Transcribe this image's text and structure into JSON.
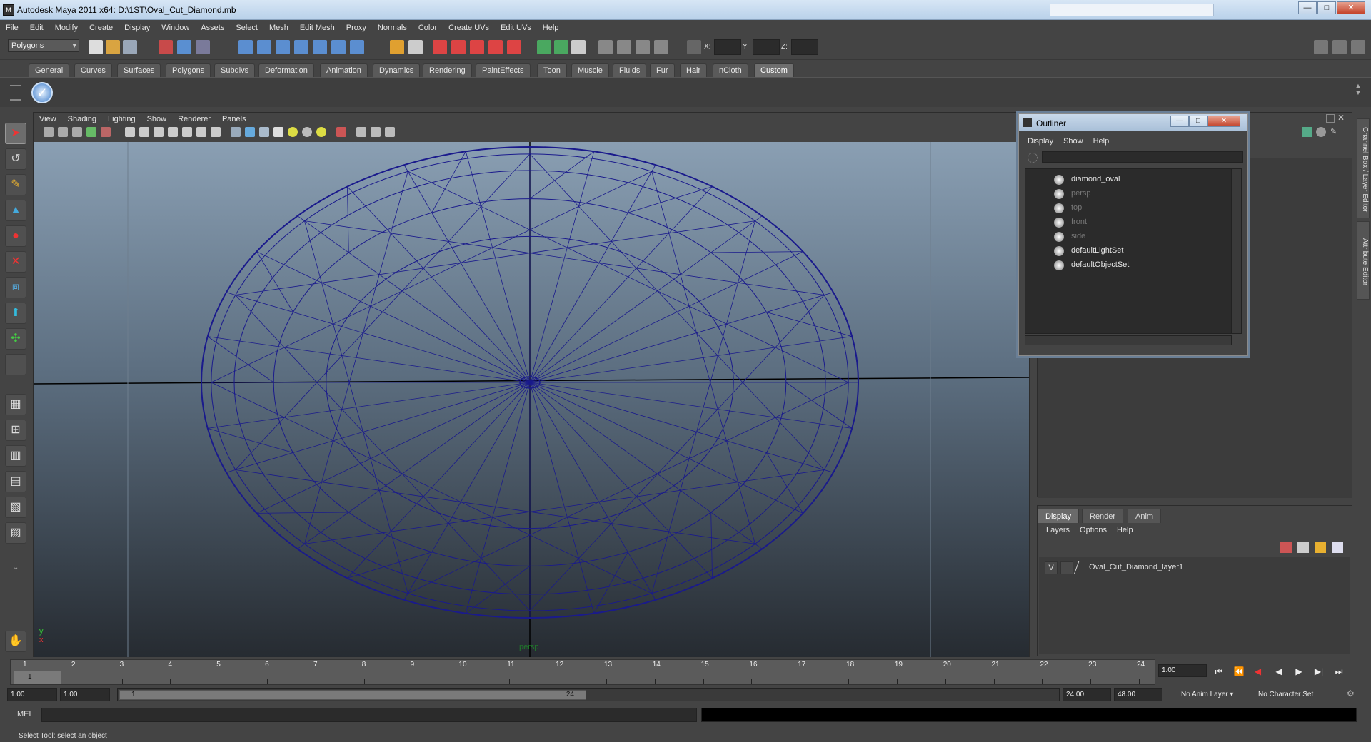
{
  "window": {
    "title": "Autodesk Maya 2011 x64: D:\\1ST\\Oval_Cut_Diamond.mb",
    "minimize": "—",
    "maximize": "□",
    "close": "✕"
  },
  "menubar": [
    "File",
    "Edit",
    "Modify",
    "Create",
    "Display",
    "Window",
    "Assets",
    "Select",
    "Mesh",
    "Edit Mesh",
    "Proxy",
    "Normals",
    "Color",
    "Create UVs",
    "Edit UVs",
    "Help"
  ],
  "statusline": {
    "mode": "Polygons",
    "x_label": "X:",
    "y_label": "Y:",
    "z_label": "Z:"
  },
  "shelf": {
    "tabs": [
      "General",
      "Curves",
      "Surfaces",
      "Polygons",
      "Subdivs",
      "Deformation",
      "Animation",
      "Dynamics",
      "Rendering",
      "PaintEffects",
      "Toon",
      "Muscle",
      "Fluids",
      "Fur",
      "Hair",
      "nCloth",
      "Custom"
    ],
    "active_tab": "Custom"
  },
  "viewport": {
    "menu": [
      "View",
      "Shading",
      "Lighting",
      "Show",
      "Renderer",
      "Panels"
    ],
    "camera": "persp",
    "axis_y": "y",
    "axis_x": "x",
    "wire_color": "#1a1a8c",
    "bg_top": "#8a9fb3",
    "bg_bottom": "#262b31"
  },
  "outliner": {
    "title": "Outliner",
    "menu": [
      "Display",
      "Show",
      "Help"
    ],
    "items": [
      {
        "label": "diamond_oval",
        "dim": false
      },
      {
        "label": "persp",
        "dim": true
      },
      {
        "label": "top",
        "dim": true
      },
      {
        "label": "front",
        "dim": true
      },
      {
        "label": "side",
        "dim": true
      },
      {
        "label": "defaultLightSet",
        "dim": false
      },
      {
        "label": "defaultObjectSet",
        "dim": false
      }
    ]
  },
  "right_tabs": [
    "Channel Box / Layer Editor",
    "Attribute Editor"
  ],
  "layer_editor": {
    "tabs": [
      "Display",
      "Render",
      "Anim"
    ],
    "active_tab": "Display",
    "menu": [
      "Layers",
      "Options",
      "Help"
    ],
    "layer": {
      "visible": "V",
      "name": "Oval_Cut_Diamond_layer1"
    }
  },
  "time_slider": {
    "ticks": [
      "1",
      "2",
      "3",
      "4",
      "5",
      "6",
      "7",
      "8",
      "9",
      "10",
      "11",
      "12",
      "13",
      "14",
      "15",
      "16",
      "17",
      "18",
      "19",
      "20",
      "21",
      "22",
      "23",
      "24"
    ],
    "current_frame": "1",
    "current_time": "1.00"
  },
  "playback": [
    "⏮",
    "⏴⏴",
    "|◀",
    "◀",
    "▶",
    "▶|"
  ],
  "range_slider": {
    "start_time": "1.00",
    "playback_start": "1.00",
    "range_start": "1",
    "range_end": "24",
    "playback_end": "24.00",
    "end_time": "48.00",
    "anim_layer": "No Anim Layer",
    "character_set": "No Character Set"
  },
  "command_line": {
    "label": "MEL"
  },
  "help_line": "Select Tool: select an object"
}
